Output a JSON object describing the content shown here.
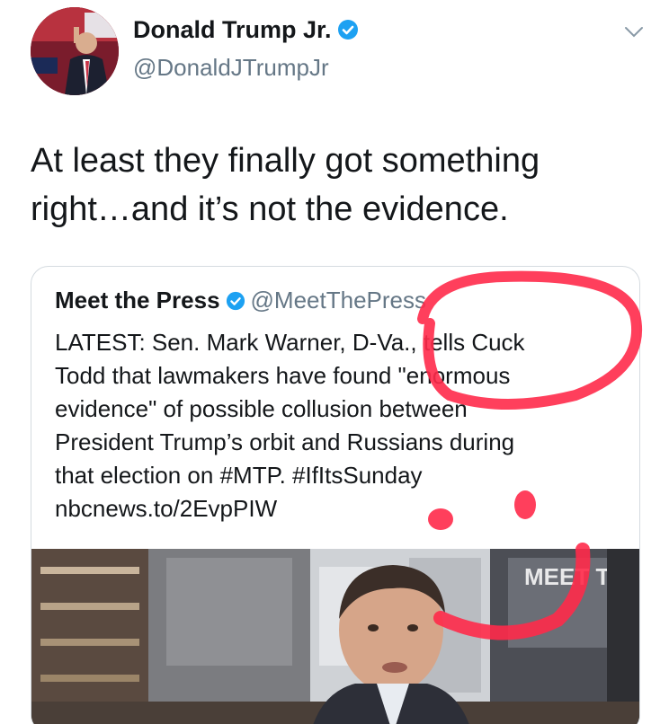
{
  "tweet": {
    "author_name": "Donald Trump Jr.",
    "author_handle": "@DonaldJTrumpJr",
    "verified_icon": "verified-badge-icon",
    "menu_icon": "chevron-down-icon",
    "text": "At least they finally got something right…and it’s not the evidence."
  },
  "quoted_tweet": {
    "author_name": "Meet the Press",
    "author_handle": "@MeetThePress",
    "lines": [
      "LATEST: Sen. Mark Warner, D-Va., tells Cuck",
      "Todd that lawmakers have found \"enormous",
      "evidence\" of possible collusion between",
      "President Trump’s orbit and Russians during",
      "that election on #MTP. #IfItsSunday"
    ],
    "link": "nbcnews.to/2EvpPIW",
    "image_caption_text": "MEET THE PRESS"
  },
  "colors": {
    "verified_blue": "#1da1f2",
    "annotation_red": "#ff2a4a",
    "handle_gray": "#657786"
  }
}
